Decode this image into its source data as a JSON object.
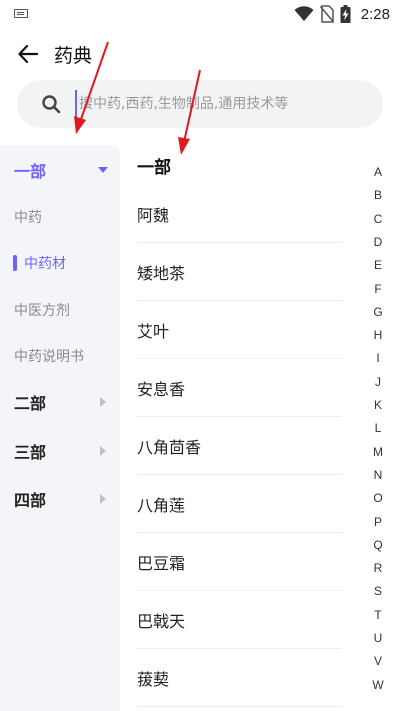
{
  "status_bar": {
    "time": "2:28",
    "icons": [
      "keyboard-icon",
      "wifi-icon",
      "no-sim-icon",
      "battery-charging-icon"
    ]
  },
  "header": {
    "title": "药典",
    "back_icon": "arrow-left-icon"
  },
  "search": {
    "placeholder": "搜中药,西药,生物制品,通用技术等",
    "value": ""
  },
  "sidebar": {
    "items": [
      {
        "label": "一部",
        "type": "top",
        "expanded": true
      },
      {
        "label": "中药",
        "type": "sub"
      },
      {
        "label": "中药材",
        "type": "sub",
        "active": true
      },
      {
        "label": "中医方剂",
        "type": "sub"
      },
      {
        "label": "中药说明书",
        "type": "sub"
      },
      {
        "label": "二部",
        "type": "top"
      },
      {
        "label": "三部",
        "type": "top"
      },
      {
        "label": "四部",
        "type": "top"
      }
    ]
  },
  "content": {
    "section_title": "一部",
    "items": [
      "阿魏",
      "矮地茶",
      "艾叶",
      "安息香",
      "八角茴香",
      "八角莲",
      "巴豆霜",
      "巴戟天",
      "菝葜"
    ]
  },
  "alphabet_index": [
    "A",
    "B",
    "C",
    "D",
    "E",
    "F",
    "G",
    "H",
    "I",
    "J",
    "K",
    "L",
    "M",
    "N",
    "O",
    "P",
    "Q",
    "R",
    "S",
    "T",
    "U",
    "V",
    "W"
  ],
  "colors": {
    "accent": "#6c63ff",
    "annotation_arrow": "#e0191f",
    "sidebar_bg": "#f4f5f8",
    "search_bg": "#f2f3f5"
  }
}
